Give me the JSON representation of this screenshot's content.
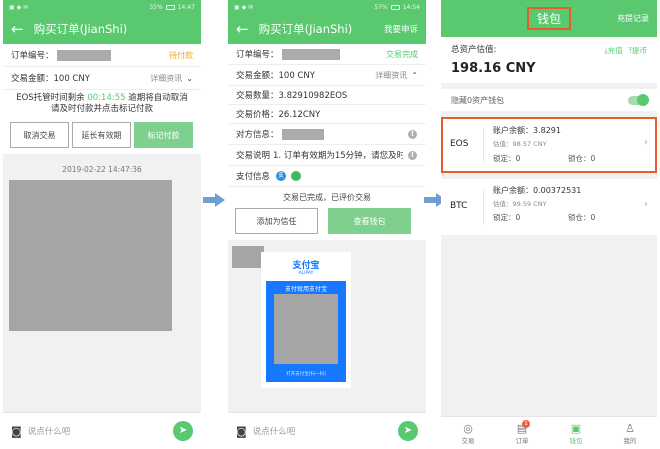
{
  "screen1": {
    "status_time": "14:47",
    "status_batt": "55%",
    "title": "购买订单(JianShi)",
    "order_label": "订单编号：",
    "order_status": "待付款",
    "amount_label": "交易金额：100 CNY",
    "details_link": "详细资讯",
    "notice_line1_prefix": "EOS托管时间剩余",
    "countdown": "00:14:55",
    "notice_line1_suffix": "逾期将自动取消",
    "notice_line2": "请及时付款并点击标记付款",
    "buttons": {
      "cancel": "取消交易",
      "extend": "延长有效期",
      "mark_paid": "标记付款"
    },
    "chat_timestamp": "2019-02-22  14:47:36",
    "chat_placeholder": "说点什么吧"
  },
  "screen2": {
    "status_time": "14:54",
    "status_batt": "57%",
    "title": "购买订单(JianShi)",
    "appeal": "我要申诉",
    "order_label": "订单编号：",
    "order_status": "交易完成",
    "amount_label": "交易金额：100 CNY",
    "details_link": "详细资讯",
    "qty_label": "交易数量：3.82910982EOS",
    "price_label": "交易价格：26.12CNY",
    "counterparty_label": "对方信息：",
    "desc_label": "交易说明",
    "desc_text": "1. 订单有效期为15分钟，请您及时在...",
    "pay_label": "支付信息",
    "completed_text": "交易已完成，已评价交易",
    "buttons": {
      "trust": "添加为信任",
      "view_wallet": "查看钱包"
    },
    "alipay_logo": "支付宝",
    "alipay_sub": "ALIPAY",
    "alipay_banner": "支付就用支付宝",
    "alipay_hint": "打开支付宝[扫一扫]",
    "chat_placeholder": "说点什么吧"
  },
  "screen3": {
    "title": "钱包",
    "history": "充提记录",
    "total_label": "总资产估值:",
    "total_value": "198.16 CNY",
    "deposit": "充值",
    "withdraw": "提币",
    "hide_zero": "隐藏0资产钱包",
    "coins": [
      {
        "name": "EOS",
        "balance": "账户余额：3.8291",
        "estimate": "估值：98.57 CNY",
        "frozen": "锁定：0",
        "locked": "锁仓：0"
      },
      {
        "name": "BTC",
        "balance": "账户余额：0.00372531",
        "estimate": "估值：99.59 CNY",
        "frozen": "锁定：0",
        "locked": "锁仓：0"
      }
    ],
    "tabs": [
      {
        "label": "交易",
        "icon": "compass-icon"
      },
      {
        "label": "订单",
        "icon": "order-icon",
        "badge": "1"
      },
      {
        "label": "钱包",
        "icon": "wallet-icon"
      },
      {
        "label": "我的",
        "icon": "user-icon"
      }
    ]
  },
  "colors": {
    "brand_green": "#5ac86f",
    "highlight_red": "#e65c2b",
    "pending_orange": "#f5a623"
  }
}
